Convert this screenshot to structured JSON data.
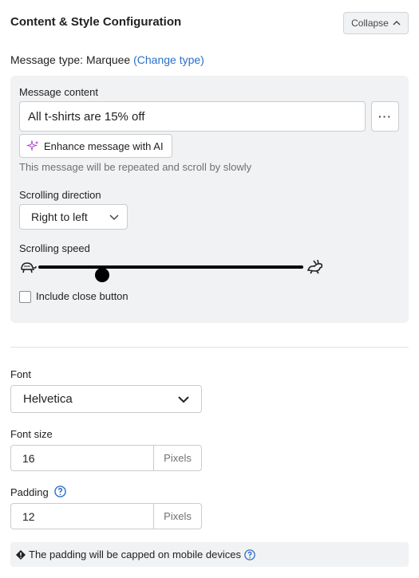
{
  "header": {
    "title": "Content & Style Configuration",
    "collapse_label": "Collapse"
  },
  "message_type": {
    "label": "Message type:",
    "value": "Marquee",
    "change_link": "(Change type)"
  },
  "message_content": {
    "label": "Message content",
    "value": "All t-shirts are 15% off",
    "more_label": "···",
    "ai_button": "Enhance message with AI",
    "help": "This message will be repeated and scroll by slowly"
  },
  "scrolling_direction": {
    "label": "Scrolling direction",
    "value": "Right to left"
  },
  "scrolling_speed": {
    "label": "Scrolling speed",
    "value_fraction": 0.24
  },
  "close_button": {
    "label": "Include close button",
    "checked": false
  },
  "font": {
    "label": "Font",
    "value": "Helvetica"
  },
  "font_size": {
    "label": "Font size",
    "value": "16",
    "unit": "Pixels"
  },
  "padding": {
    "label": "Padding",
    "value": "12",
    "unit": "Pixels"
  },
  "notice": {
    "text": "The padding will be capped on mobile devices"
  },
  "colors": {
    "accent": "#2c6ecb",
    "panel_bg": "#f1f2f3",
    "ai_icon": "#b44ec7"
  }
}
